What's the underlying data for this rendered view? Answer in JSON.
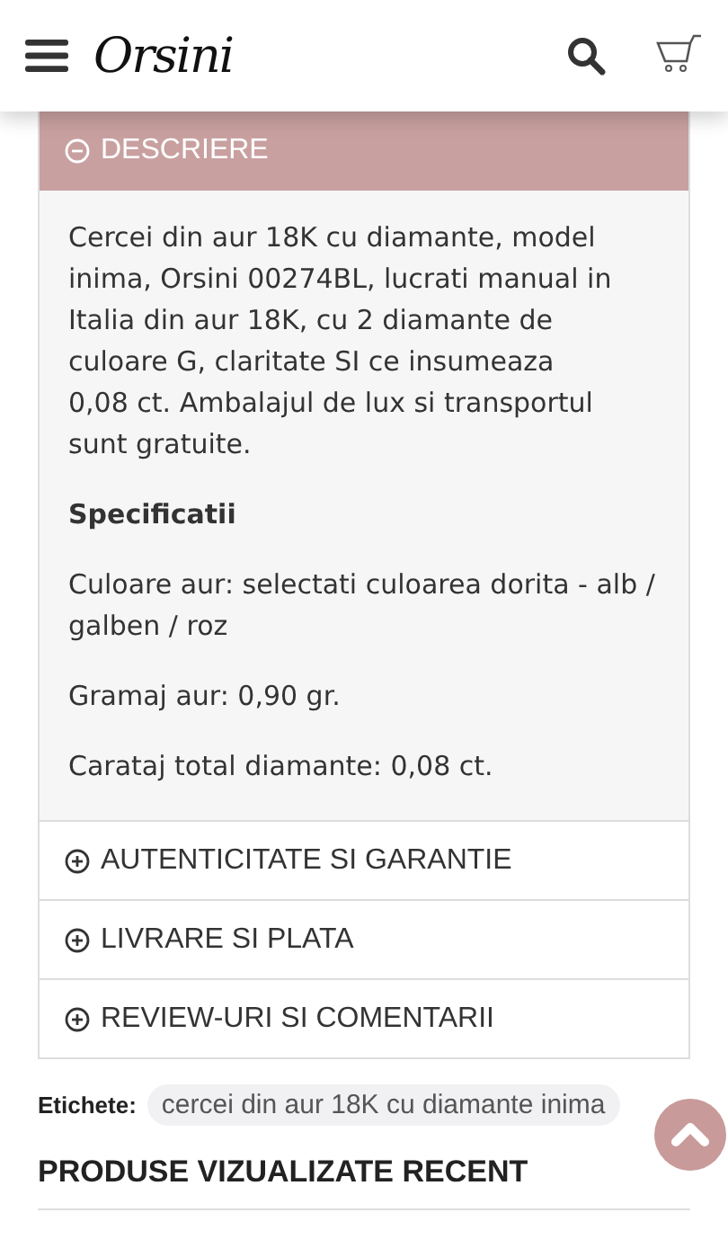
{
  "header": {
    "logo": "Orsini"
  },
  "sections": [
    {
      "title": "DESCRIERE",
      "expanded": true,
      "content": [
        {
          "kind": "paragraph",
          "text": "Cercei din aur 18K cu diamante, model inima, Orsini 00274BL, lucrati manual in Italia din aur 18K, cu 2 diamante de culoare G, claritate SI ce insumeaza\n0,08 ct. Ambalajul de lux si transportul sunt gratuite."
        },
        {
          "kind": "heading",
          "text": "Specificatii"
        },
        {
          "kind": "paragraph",
          "text": "Culoare aur: selectati culoarea dorita - alb / galben / roz"
        },
        {
          "kind": "paragraph",
          "text": "Gramaj aur: 0,90 gr."
        },
        {
          "kind": "paragraph",
          "text": "Carataj total diamante: 0,08 ct."
        }
      ]
    },
    {
      "title": "AUTENTICITATE SI GARANTIE",
      "expanded": false
    },
    {
      "title": "LIVRARE SI PLATA",
      "expanded": false
    },
    {
      "title": "REVIEW-URI SI COMENTARII",
      "expanded": false
    }
  ],
  "tags": {
    "label": "Etichete:",
    "items": [
      "cercei din aur 18K cu diamante inima"
    ]
  },
  "recent": {
    "title": "PRODUSE VIZUALIZATE RECENT"
  }
}
